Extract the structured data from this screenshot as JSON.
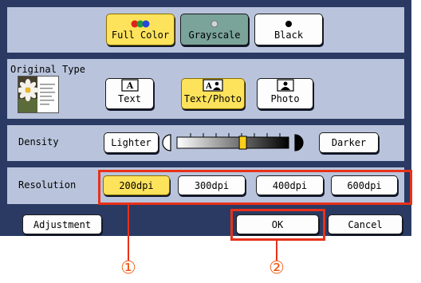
{
  "color_mode": {
    "options": [
      {
        "label": "Full Color",
        "selected": true
      },
      {
        "label": "Grayscale",
        "selected": false
      },
      {
        "label": "Black",
        "selected": false
      }
    ]
  },
  "original_type": {
    "label": "Original Type",
    "options": [
      {
        "label": "Text",
        "icon": "text-doc-icon",
        "selected": false
      },
      {
        "label": "Text/Photo",
        "icon": "text-photo-doc-icon",
        "selected": true
      },
      {
        "label": "Photo",
        "icon": "photo-doc-icon",
        "selected": false
      }
    ]
  },
  "density": {
    "label": "Density",
    "lighter_label": "Lighter",
    "darker_label": "Darker",
    "level": 0.59
  },
  "resolution": {
    "label": "Resolution",
    "options": [
      {
        "label": "200dpi",
        "selected": true
      },
      {
        "label": "300dpi",
        "selected": false
      },
      {
        "label": "400dpi",
        "selected": false
      },
      {
        "label": "600dpi",
        "selected": false
      }
    ]
  },
  "footer": {
    "adjustment_label": "Adjustment",
    "ok_label": "OK",
    "cancel_label": "Cancel"
  },
  "callouts": {
    "one": "①",
    "two": "②"
  },
  "colors": {
    "panel": "#2a3a63",
    "row": "#b9c4dc",
    "selected": "#fde25c",
    "highlight": "#e8311a",
    "callout_text": "#f05a14"
  }
}
